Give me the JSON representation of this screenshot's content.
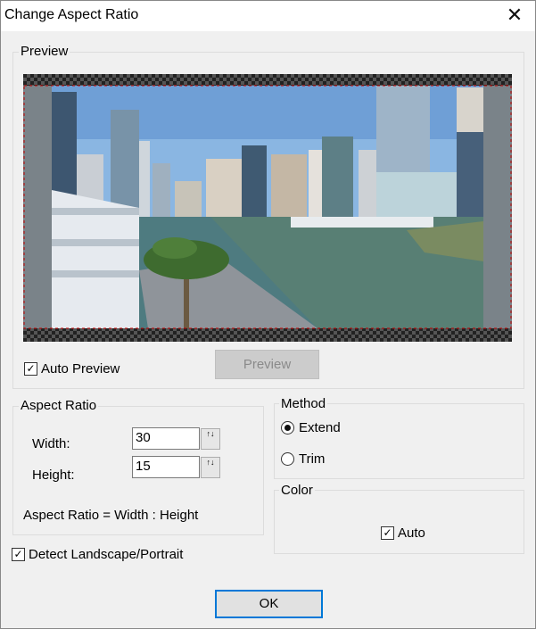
{
  "dialog": {
    "title": "Change Aspect Ratio",
    "close_glyph": "✕"
  },
  "preview": {
    "group_label": "Preview",
    "auto_preview_label": "Auto Preview",
    "auto_preview_checked": true,
    "preview_button_label": "Preview"
  },
  "aspect_ratio": {
    "group_label": "Aspect Ratio",
    "width_label": "Width:",
    "width_value": "30",
    "height_label": "Height:",
    "height_value": "15",
    "formula": "Aspect Ratio = Width : Height"
  },
  "method": {
    "group_label": "Method",
    "options": [
      {
        "label": "Extend",
        "selected": true
      },
      {
        "label": "Trim",
        "selected": false
      }
    ]
  },
  "color": {
    "group_label": "Color",
    "auto_label": "Auto",
    "auto_checked": true
  },
  "detect_label": "Detect Landscape/Portrait",
  "detect_checked": true,
  "ok_label": "OK",
  "check_glyph": "✓",
  "spin_glyph": "↑↓"
}
